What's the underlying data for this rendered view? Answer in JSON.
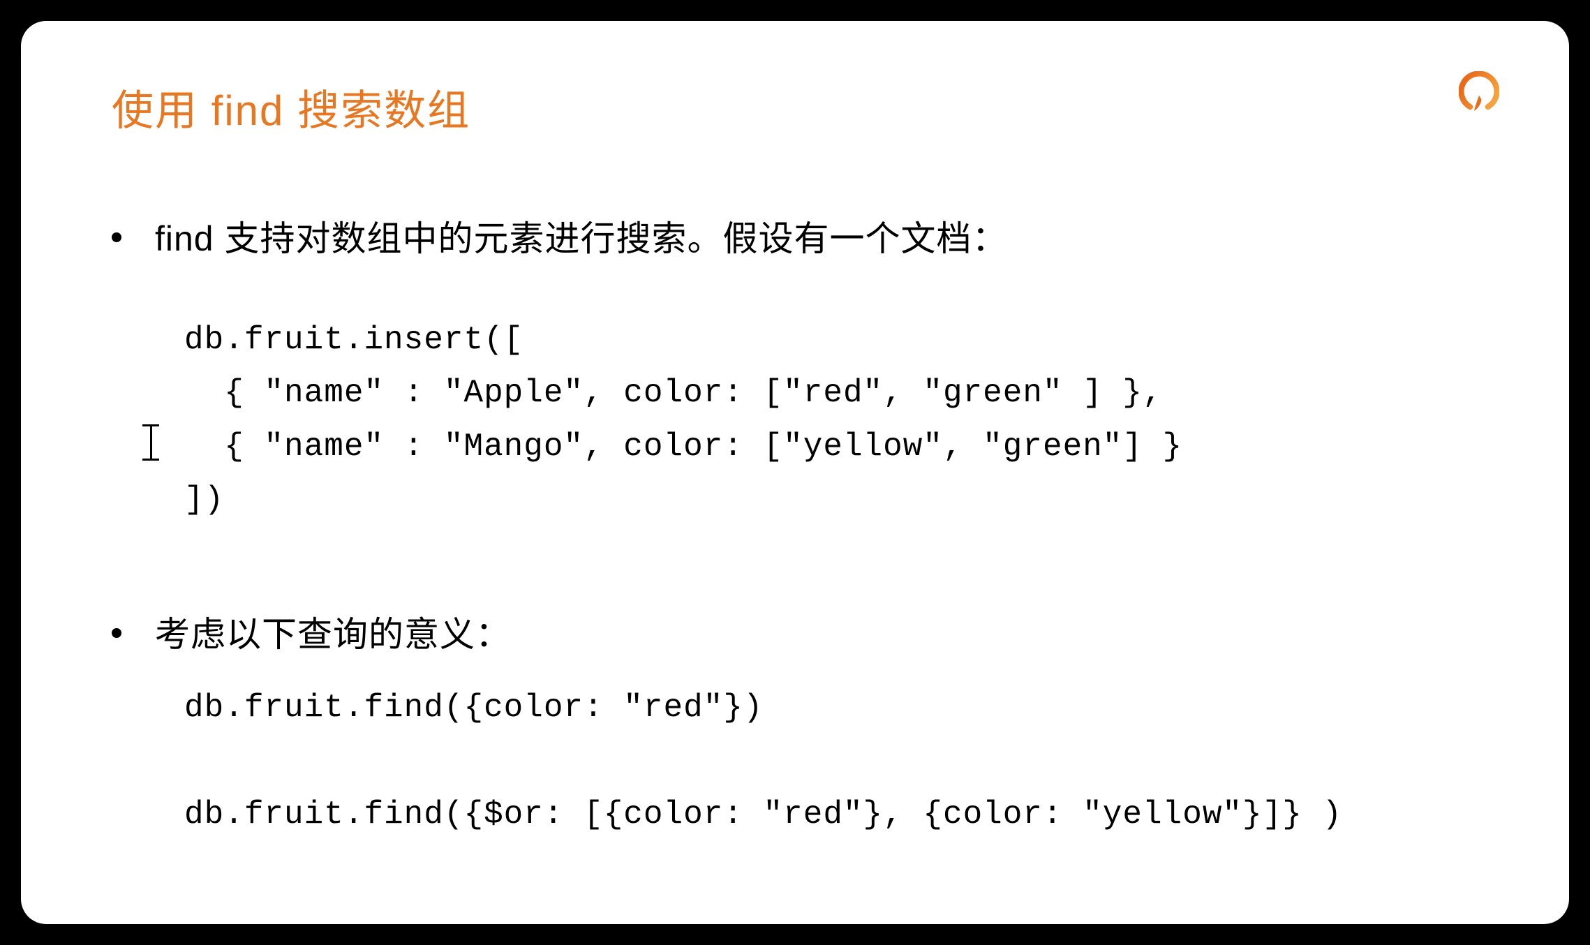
{
  "title": "使用 find 搜索数组",
  "bullets": [
    {
      "text": "find 支持对数组中的元素进行搜索。假设有一个文档：",
      "code": "db.fruit.insert([\n  { \"name\" : \"Apple\", color: [\"red\", \"green\" ] },\n  { \"name\" : \"Mango\", color: [\"yellow\", \"green\"] }\n])"
    },
    {
      "text": "考虑以下查询的意义：",
      "code": "db.fruit.find({color: \"red\"})\n\ndb.fruit.find({$or: [{color: \"red\"}, {color: \"yellow\"}]} )"
    }
  ],
  "colors": {
    "accent": "#e87722"
  }
}
